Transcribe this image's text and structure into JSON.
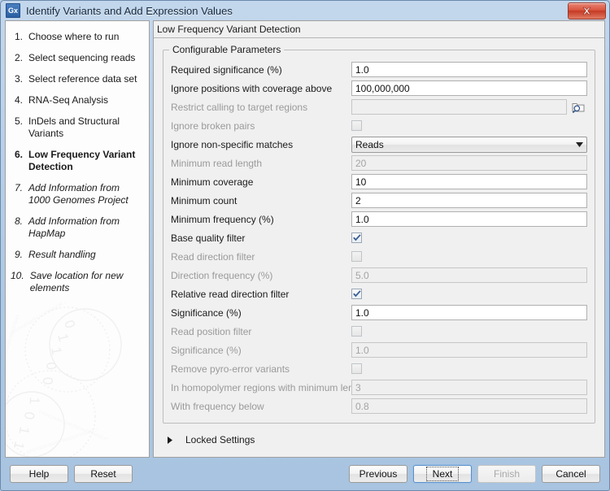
{
  "window": {
    "title": "Identify Variants and Add Expression Values",
    "app_icon": "gx-icon",
    "app_icon_text": "Gx",
    "close_label": "Close",
    "close_icon": "close-icon"
  },
  "sidebar": {
    "steps": [
      {
        "num": "1.",
        "label": "Choose where to run",
        "state": "done"
      },
      {
        "num": "2.",
        "label": "Select sequencing reads",
        "state": "done"
      },
      {
        "num": "3.",
        "label": "Select reference data set",
        "state": "done"
      },
      {
        "num": "4.",
        "label": "RNA-Seq Analysis",
        "state": "done"
      },
      {
        "num": "5.",
        "label": "InDels and Structural Variants",
        "state": "done"
      },
      {
        "num": "6.",
        "label": "Low Frequency Variant Detection",
        "state": "current"
      },
      {
        "num": "7.",
        "label": "Add Information from 1000 Genomes Project",
        "state": "future"
      },
      {
        "num": "8.",
        "label": "Add Information from HapMap",
        "state": "future"
      },
      {
        "num": "9.",
        "label": "Result handling",
        "state": "future"
      },
      {
        "num": "10.",
        "label": "Save location for new elements",
        "state": "future"
      }
    ]
  },
  "main": {
    "panel_title": "Low Frequency Variant Detection",
    "group_legend": "Configurable Parameters",
    "rows": [
      {
        "label": "Required significance (%)",
        "type": "text",
        "value": "1.0",
        "disabled": false
      },
      {
        "label": "Ignore positions with coverage above",
        "type": "text",
        "value": "100,000,000",
        "disabled": false
      },
      {
        "label": "Restrict calling to target regions",
        "type": "browse",
        "value": "",
        "disabled": true,
        "icon": "browse-folder-search-icon"
      },
      {
        "label": "Ignore broken pairs",
        "type": "checkbox",
        "checked": false,
        "disabled": true
      },
      {
        "label": "Ignore non-specific matches",
        "type": "combo",
        "value": "Reads",
        "disabled": false,
        "icon": "chevron-down-icon"
      },
      {
        "label": "Minimum read length",
        "type": "text",
        "value": "20",
        "disabled": true
      },
      {
        "label": "Minimum coverage",
        "type": "text",
        "value": "10",
        "disabled": false
      },
      {
        "label": "Minimum count",
        "type": "text",
        "value": "2",
        "disabled": false
      },
      {
        "label": "Minimum frequency (%)",
        "type": "text",
        "value": "1.0",
        "disabled": false
      },
      {
        "label": "Base quality filter",
        "type": "checkbox",
        "checked": true,
        "disabled": false
      },
      {
        "label": "Read direction filter",
        "type": "checkbox",
        "checked": false,
        "disabled": true
      },
      {
        "label": "Direction frequency (%)",
        "type": "text",
        "value": "5.0",
        "disabled": true
      },
      {
        "label": "Relative read direction filter",
        "type": "checkbox",
        "checked": true,
        "disabled": false
      },
      {
        "label": "Significance (%)",
        "type": "text",
        "value": "1.0",
        "disabled": false
      },
      {
        "label": "Read position filter",
        "type": "checkbox",
        "checked": false,
        "disabled": true
      },
      {
        "label": "Significance (%)",
        "type": "text",
        "value": "1.0",
        "disabled": true
      },
      {
        "label": "Remove pyro-error variants",
        "type": "checkbox",
        "checked": false,
        "disabled": true
      },
      {
        "label": "In homopolymer regions with minimum length",
        "type": "text",
        "value": "3",
        "disabled": true
      },
      {
        "label": "With frequency below",
        "type": "text",
        "value": "0.8",
        "disabled": true
      }
    ],
    "locked_settings": {
      "label": "Locked Settings",
      "expanded": false,
      "icon": "triangle-right-icon"
    }
  },
  "footer": {
    "help": "Help",
    "reset": "Reset",
    "previous": "Previous",
    "next": "Next",
    "finish": "Finish",
    "cancel": "Cancel"
  },
  "colors": {
    "title_bar": "#aec9e4",
    "close_button": "#d9543e",
    "panel_bg": "#f0f0f0",
    "sidebar_bg": "#fdfdfd",
    "check_mark": "#3a5f96"
  }
}
